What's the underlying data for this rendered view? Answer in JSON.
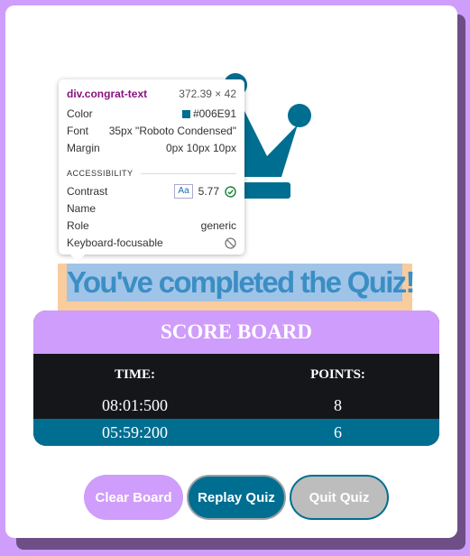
{
  "congrat": {
    "text": "You've completed the Quiz!"
  },
  "scoreboard": {
    "title": "SCORE BOARD",
    "columns": [
      "TIME:",
      "POINTS:"
    ],
    "rows": [
      {
        "time": "08:01:500",
        "points": "8"
      },
      {
        "time": "05:59:200",
        "points": "6"
      }
    ]
  },
  "buttons": {
    "clear": "Clear Board",
    "replay": "Replay Quiz",
    "quit": "Quit Quiz"
  },
  "devtools_tooltip": {
    "selector": "div.congrat-text",
    "size": "372.39 × 42",
    "color_label": "Color",
    "color_value": "#006E91",
    "font_label": "Font",
    "font_value": "35px \"Roboto Condensed\"",
    "margin_label": "Margin",
    "margin_value": "0px 10px 10px",
    "accessibility_heading": "ACCESSIBILITY",
    "contrast_label": "Contrast",
    "contrast_badge": "Aa",
    "contrast_value": "5.77",
    "name_label": "Name",
    "role_label": "Role",
    "role_value": "generic",
    "focusable_label": "Keyboard-focusable"
  },
  "colors": {
    "page_bg": "#cf9dfb",
    "accent_teal": "#006e91",
    "scoreboard_dark": "#15161a",
    "highlight_margin": "#f9cc9d",
    "highlight_content": "#9fc4e8"
  },
  "icons": {
    "crown": "crown-icon",
    "contrast_check": "check-circle-icon",
    "not_focusable": "blocked-circle-icon"
  }
}
